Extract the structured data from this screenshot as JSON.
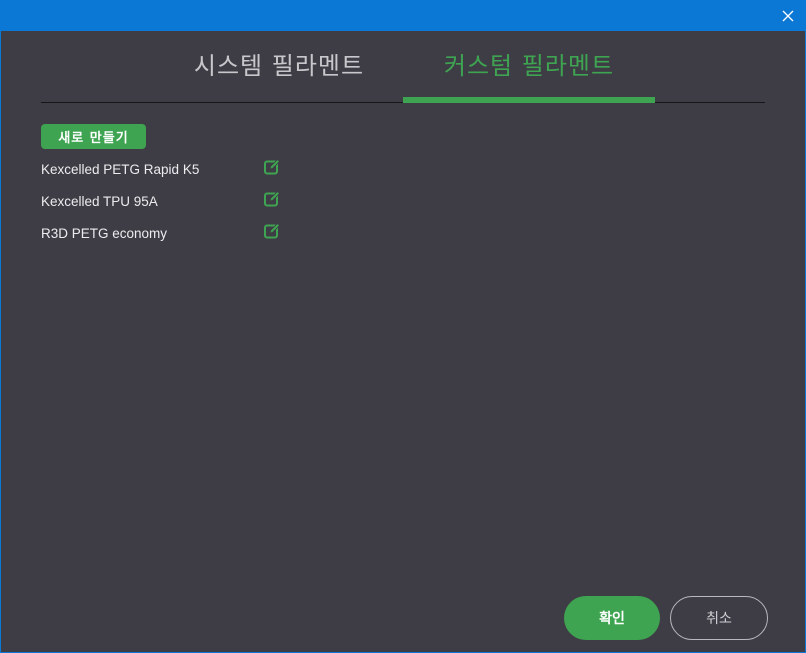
{
  "tabs": {
    "system_label": "시스템 필라멘트",
    "custom_label": "커스텀 필라멘트",
    "active": "custom"
  },
  "new_button_label": "새로 만들기",
  "filaments": [
    {
      "label": "Kexcelled PETG Rapid K5"
    },
    {
      "label": "Kexcelled TPU 95A"
    },
    {
      "label": "R3D PETG economy"
    }
  ],
  "footer": {
    "ok_label": "확인",
    "cancel_label": "취소"
  },
  "colors": {
    "accent": "#3fa452",
    "titlebar": "#0a78d4",
    "background": "#3e3d45"
  },
  "icons": {
    "close": "close-icon",
    "edit": "edit-icon"
  }
}
